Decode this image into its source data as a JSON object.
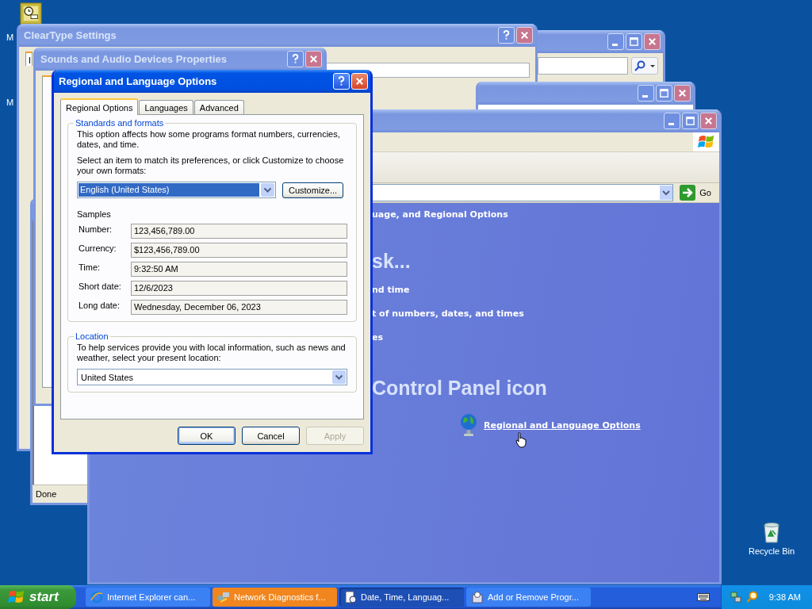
{
  "desktop": {
    "icons": [
      {
        "kind": "scheduler",
        "label": "M"
      },
      {
        "kind": "covered",
        "label": "M"
      },
      {
        "kind": "recycle",
        "label": "Recycle Bin"
      }
    ]
  },
  "cleartype": {
    "title": "ClearType Settings",
    "tab_label": "I"
  },
  "sounds": {
    "title": "Sounds and Audio Devices Properties"
  },
  "browser": {
    "status": "Done"
  },
  "control_panel": {
    "go_label": "Go",
    "header": "uage, and Regional Options",
    "task_heading": "sk...",
    "tasks": [
      "nd time",
      "t of numbers, dates, and times",
      "es"
    ],
    "icon_heading": "Control Panel icon",
    "icon_link": "Regional and Language Options"
  },
  "regional": {
    "title": "Regional and Language Options",
    "tabs": [
      {
        "label": "Regional Options",
        "selected": true
      },
      {
        "label": "Languages",
        "selected": false
      },
      {
        "label": "Advanced",
        "selected": false
      }
    ],
    "standards": {
      "legend": "Standards and formats",
      "description": "This option affects how some programs format numbers, currencies, dates, and time.",
      "instruction": "Select an item to match its preferences, or click Customize to choose your own formats:",
      "format": "English (United States)",
      "customize": "Customize...",
      "samples_label": "Samples",
      "samples": [
        {
          "label": "Number:",
          "value": "123,456,789.00"
        },
        {
          "label": "Currency:",
          "value": "$123,456,789.00"
        },
        {
          "label": "Time:",
          "value": "9:32:50 AM"
        },
        {
          "label": "Short date:",
          "value": "12/6/2023"
        },
        {
          "label": "Long date:",
          "value": "Wednesday, December 06, 2023"
        }
      ]
    },
    "location": {
      "legend": "Location",
      "description": "To help services provide you with local information, such as news and weather, select your present location:",
      "value": "United States"
    },
    "buttons": [
      {
        "label": "OK",
        "default": true,
        "disabled": false
      },
      {
        "label": "Cancel",
        "default": false,
        "disabled": false
      },
      {
        "label": "Apply",
        "default": false,
        "disabled": true
      }
    ]
  },
  "taskbar": {
    "start": "start",
    "tasks": [
      {
        "kind": "browser",
        "label": "Internet Explorer can...",
        "selected": false,
        "flashing": false
      },
      {
        "kind": "network",
        "label": "Network Diagnostics f...",
        "selected": false,
        "flashing": true
      },
      {
        "kind": "datetime",
        "label": "Date, Time, Languag...",
        "selected": true,
        "flashing": false
      },
      {
        "kind": "programs",
        "label": "Add or Remove Progr...",
        "selected": false,
        "flashing": false
      }
    ],
    "clock": "9:38 AM"
  }
}
